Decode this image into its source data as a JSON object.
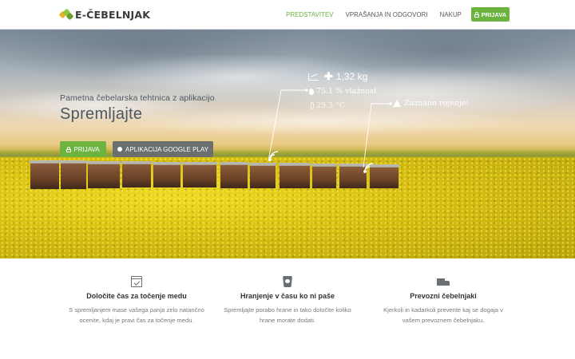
{
  "navbar": {
    "logo_text": "E-ČEBELNJAK",
    "menu": [
      {
        "label": "PREDSTAVITEV",
        "active": true
      },
      {
        "label": "VPRAŠANJA IN ODGOVORI",
        "active": false
      },
      {
        "label": "NAKUP",
        "active": false
      }
    ],
    "login_label": "PRIJAVA"
  },
  "hero": {
    "subtitle": "Pametna čebelarska tehtnica z aplikacijo",
    "title": "Spremljajte",
    "login_button": "PRIJAVA",
    "play_button": "APLIKACIJA GOOGLE PLAY",
    "overlay": {
      "weight": "1,32 kg",
      "humidity": "75.1 % vlažnost",
      "temperature": "29.3 °C",
      "alert": "Zaznano rojenje!"
    }
  },
  "features": [
    {
      "icon": "calendar-check-icon",
      "title": "Določite čas za točenje medu",
      "text": "S spremljanjem mase vašega panja zelo natančno ocenite, kdaj je pravi čas za točenje medu."
    },
    {
      "icon": "feeder-bucket-icon",
      "title": "Hranjenje v času ko ni paše",
      "text": "Spremljajte porabo hrane in tako določite koliko hrane morate dodati."
    },
    {
      "icon": "truck-icon",
      "title": "Prevozni čebelnjaki",
      "text": "Kjerkoli in kadarkoli preverite kaj se dogaja v vašem prevoznem čebelnjaku."
    }
  ],
  "colors": {
    "accent": "#6cb33f",
    "secondary_button": "#6b6f70",
    "heading_text": "#4c5863"
  }
}
